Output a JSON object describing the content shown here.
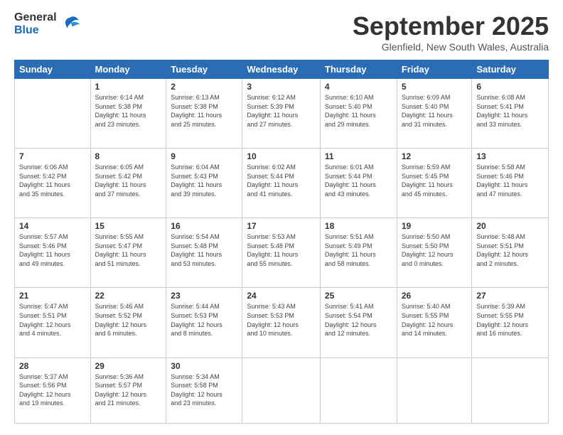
{
  "header": {
    "logo": {
      "general": "General",
      "blue": "Blue"
    },
    "title": "September 2025",
    "location": "Glenfield, New South Wales, Australia"
  },
  "weekdays": [
    "Sunday",
    "Monday",
    "Tuesday",
    "Wednesday",
    "Thursday",
    "Friday",
    "Saturday"
  ],
  "weeks": [
    [
      {
        "day": "",
        "info": ""
      },
      {
        "day": "1",
        "info": "Sunrise: 6:14 AM\nSunset: 5:38 PM\nDaylight: 11 hours\nand 23 minutes."
      },
      {
        "day": "2",
        "info": "Sunrise: 6:13 AM\nSunset: 5:38 PM\nDaylight: 11 hours\nand 25 minutes."
      },
      {
        "day": "3",
        "info": "Sunrise: 6:12 AM\nSunset: 5:39 PM\nDaylight: 11 hours\nand 27 minutes."
      },
      {
        "day": "4",
        "info": "Sunrise: 6:10 AM\nSunset: 5:40 PM\nDaylight: 11 hours\nand 29 minutes."
      },
      {
        "day": "5",
        "info": "Sunrise: 6:09 AM\nSunset: 5:40 PM\nDaylight: 11 hours\nand 31 minutes."
      },
      {
        "day": "6",
        "info": "Sunrise: 6:08 AM\nSunset: 5:41 PM\nDaylight: 11 hours\nand 33 minutes."
      }
    ],
    [
      {
        "day": "7",
        "info": "Sunrise: 6:06 AM\nSunset: 5:42 PM\nDaylight: 11 hours\nand 35 minutes."
      },
      {
        "day": "8",
        "info": "Sunrise: 6:05 AM\nSunset: 5:42 PM\nDaylight: 11 hours\nand 37 minutes."
      },
      {
        "day": "9",
        "info": "Sunrise: 6:04 AM\nSunset: 5:43 PM\nDaylight: 11 hours\nand 39 minutes."
      },
      {
        "day": "10",
        "info": "Sunrise: 6:02 AM\nSunset: 5:44 PM\nDaylight: 11 hours\nand 41 minutes."
      },
      {
        "day": "11",
        "info": "Sunrise: 6:01 AM\nSunset: 5:44 PM\nDaylight: 11 hours\nand 43 minutes."
      },
      {
        "day": "12",
        "info": "Sunrise: 5:59 AM\nSunset: 5:45 PM\nDaylight: 11 hours\nand 45 minutes."
      },
      {
        "day": "13",
        "info": "Sunrise: 5:58 AM\nSunset: 5:46 PM\nDaylight: 11 hours\nand 47 minutes."
      }
    ],
    [
      {
        "day": "14",
        "info": "Sunrise: 5:57 AM\nSunset: 5:46 PM\nDaylight: 11 hours\nand 49 minutes."
      },
      {
        "day": "15",
        "info": "Sunrise: 5:55 AM\nSunset: 5:47 PM\nDaylight: 11 hours\nand 51 minutes."
      },
      {
        "day": "16",
        "info": "Sunrise: 5:54 AM\nSunset: 5:48 PM\nDaylight: 11 hours\nand 53 minutes."
      },
      {
        "day": "17",
        "info": "Sunrise: 5:53 AM\nSunset: 5:48 PM\nDaylight: 11 hours\nand 55 minutes."
      },
      {
        "day": "18",
        "info": "Sunrise: 5:51 AM\nSunset: 5:49 PM\nDaylight: 11 hours\nand 58 minutes."
      },
      {
        "day": "19",
        "info": "Sunrise: 5:50 AM\nSunset: 5:50 PM\nDaylight: 12 hours\nand 0 minutes."
      },
      {
        "day": "20",
        "info": "Sunrise: 5:48 AM\nSunset: 5:51 PM\nDaylight: 12 hours\nand 2 minutes."
      }
    ],
    [
      {
        "day": "21",
        "info": "Sunrise: 5:47 AM\nSunset: 5:51 PM\nDaylight: 12 hours\nand 4 minutes."
      },
      {
        "day": "22",
        "info": "Sunrise: 5:46 AM\nSunset: 5:52 PM\nDaylight: 12 hours\nand 6 minutes."
      },
      {
        "day": "23",
        "info": "Sunrise: 5:44 AM\nSunset: 5:53 PM\nDaylight: 12 hours\nand 8 minutes."
      },
      {
        "day": "24",
        "info": "Sunrise: 5:43 AM\nSunset: 5:53 PM\nDaylight: 12 hours\nand 10 minutes."
      },
      {
        "day": "25",
        "info": "Sunrise: 5:41 AM\nSunset: 5:54 PM\nDaylight: 12 hours\nand 12 minutes."
      },
      {
        "day": "26",
        "info": "Sunrise: 5:40 AM\nSunset: 5:55 PM\nDaylight: 12 hours\nand 14 minutes."
      },
      {
        "day": "27",
        "info": "Sunrise: 5:39 AM\nSunset: 5:55 PM\nDaylight: 12 hours\nand 16 minutes."
      }
    ],
    [
      {
        "day": "28",
        "info": "Sunrise: 5:37 AM\nSunset: 5:56 PM\nDaylight: 12 hours\nand 19 minutes."
      },
      {
        "day": "29",
        "info": "Sunrise: 5:36 AM\nSunset: 5:57 PM\nDaylight: 12 hours\nand 21 minutes."
      },
      {
        "day": "30",
        "info": "Sunrise: 5:34 AM\nSunset: 5:58 PM\nDaylight: 12 hours\nand 23 minutes."
      },
      {
        "day": "",
        "info": ""
      },
      {
        "day": "",
        "info": ""
      },
      {
        "day": "",
        "info": ""
      },
      {
        "day": "",
        "info": ""
      }
    ]
  ]
}
